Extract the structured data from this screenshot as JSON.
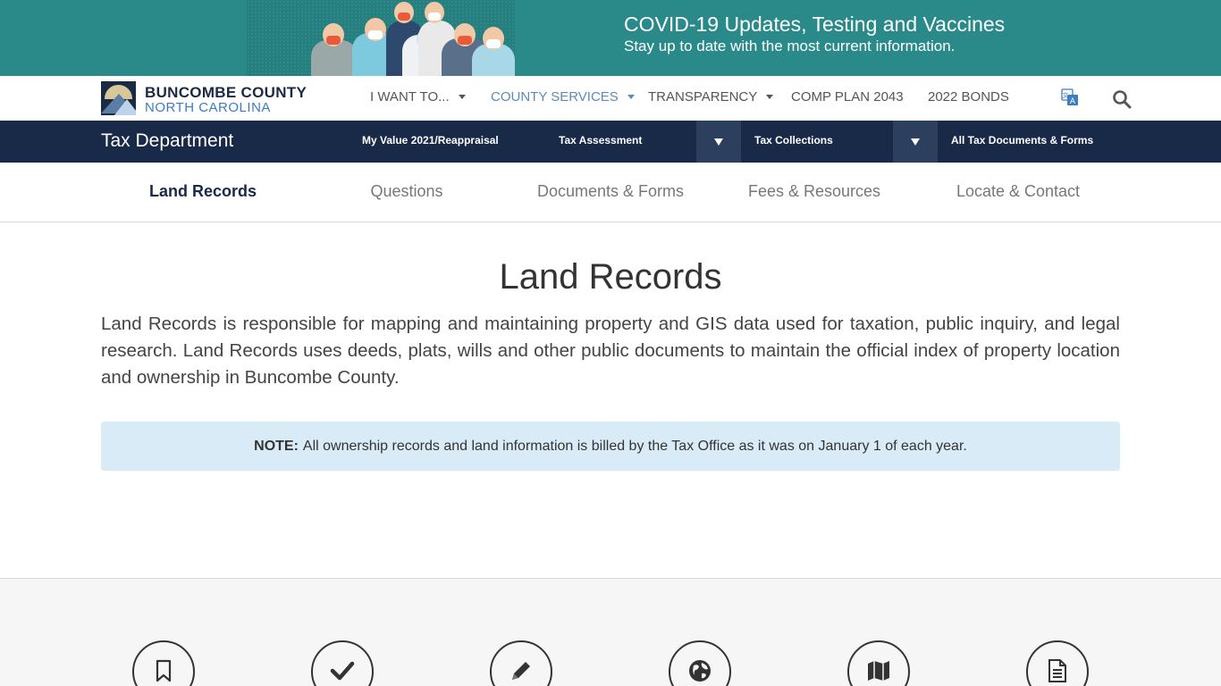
{
  "covid": {
    "title": "COVID-19 Updates, Testing and Vaccines",
    "subtitle": "Stay up to date with the most current information."
  },
  "logo": {
    "name": "BUNCOMBE COUNTY",
    "state": "NORTH CAROLINA"
  },
  "nav": {
    "i_want_to": "I WANT TO...",
    "county_services": "COUNTY SERVICES",
    "transparency": "TRANSPARENCY",
    "comp_plan": "COMP PLAN 2043",
    "bonds": "2022 BONDS"
  },
  "tax": {
    "title": "Tax Department",
    "my_value": "My Value 2021/Reappraisal",
    "assessment": "Tax Assessment",
    "collections": "Tax Collections",
    "documents": "All Tax Documents & Forms"
  },
  "subnav": {
    "land_records": "Land Records",
    "questions": "Questions",
    "documents_forms": "Documents & Forms",
    "fees_resources": "Fees & Resources",
    "locate_contact": "Locate & Contact"
  },
  "content": {
    "title": "Land Records",
    "intro": "Land Records is responsible for mapping and maintaining property and GIS data used for taxation, public inquiry, and legal research. Land Records uses deeds, plats, wills and other public documents to maintain the official index of property location and ownership in Buncombe County.",
    "note_label": "NOTE:",
    "note_text": "All ownership records and land information is billed by the Tax Office as it was on January 1 of each year."
  },
  "colors": {
    "banner": "#2a8a8a",
    "tax_bar": "#182a47",
    "note_bg": "#d9ebf7",
    "active_nav": "#5b8bb7"
  },
  "icons": [
    "bookmark-icon",
    "checkmark-icon",
    "pencil-icon",
    "globe-icon",
    "map-icon",
    "document-icon"
  ]
}
